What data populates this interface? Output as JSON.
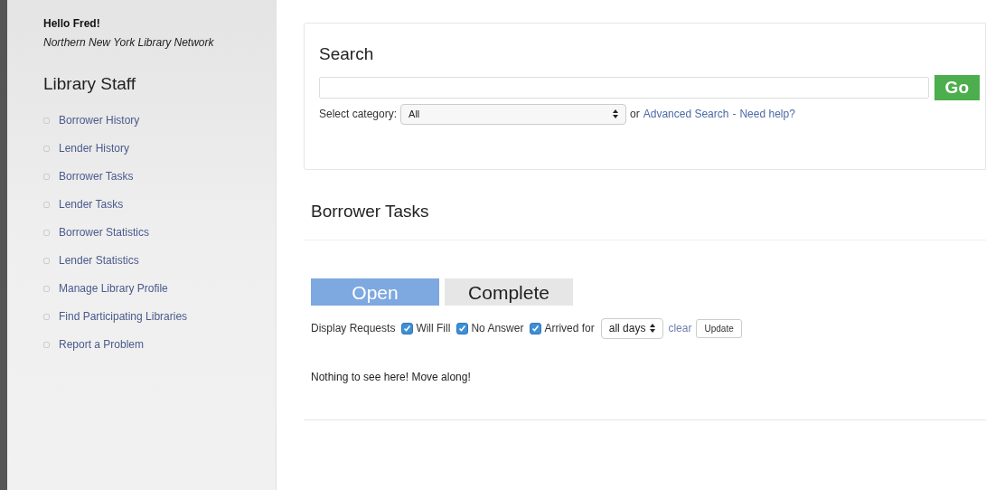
{
  "greeting": "Hello Fred!",
  "organization": "Northern New York Library Network",
  "sidebar": {
    "title": "Library Staff",
    "items": [
      {
        "label": "Borrower History"
      },
      {
        "label": "Lender History"
      },
      {
        "label": "Borrower Tasks"
      },
      {
        "label": "Lender Tasks"
      },
      {
        "label": "Borrower Statistics"
      },
      {
        "label": "Lender Statistics"
      },
      {
        "label": "Manage Library Profile"
      },
      {
        "label": "Find Participating Libraries"
      },
      {
        "label": "Report a Problem"
      }
    ]
  },
  "search": {
    "title": "Search",
    "button": "Go",
    "category_label": "Select category:",
    "category": "All",
    "or": "or",
    "advanced_link": "Advanced Search",
    "separator": "-",
    "help_link": "Need help?"
  },
  "tasks": {
    "title": "Borrower Tasks",
    "tabs": [
      {
        "label": "Open",
        "selected": true
      },
      {
        "label": "Complete",
        "selected": false
      }
    ],
    "filter_label": "Display Requests",
    "filters": [
      {
        "label": "Will Fill",
        "checked": true
      },
      {
        "label": "No Answer",
        "checked": true
      },
      {
        "label": "Arrived for",
        "checked": true
      }
    ],
    "period": "all days",
    "clear": "clear",
    "update": "Update",
    "message": "Nothing to see here! Move along!"
  }
}
